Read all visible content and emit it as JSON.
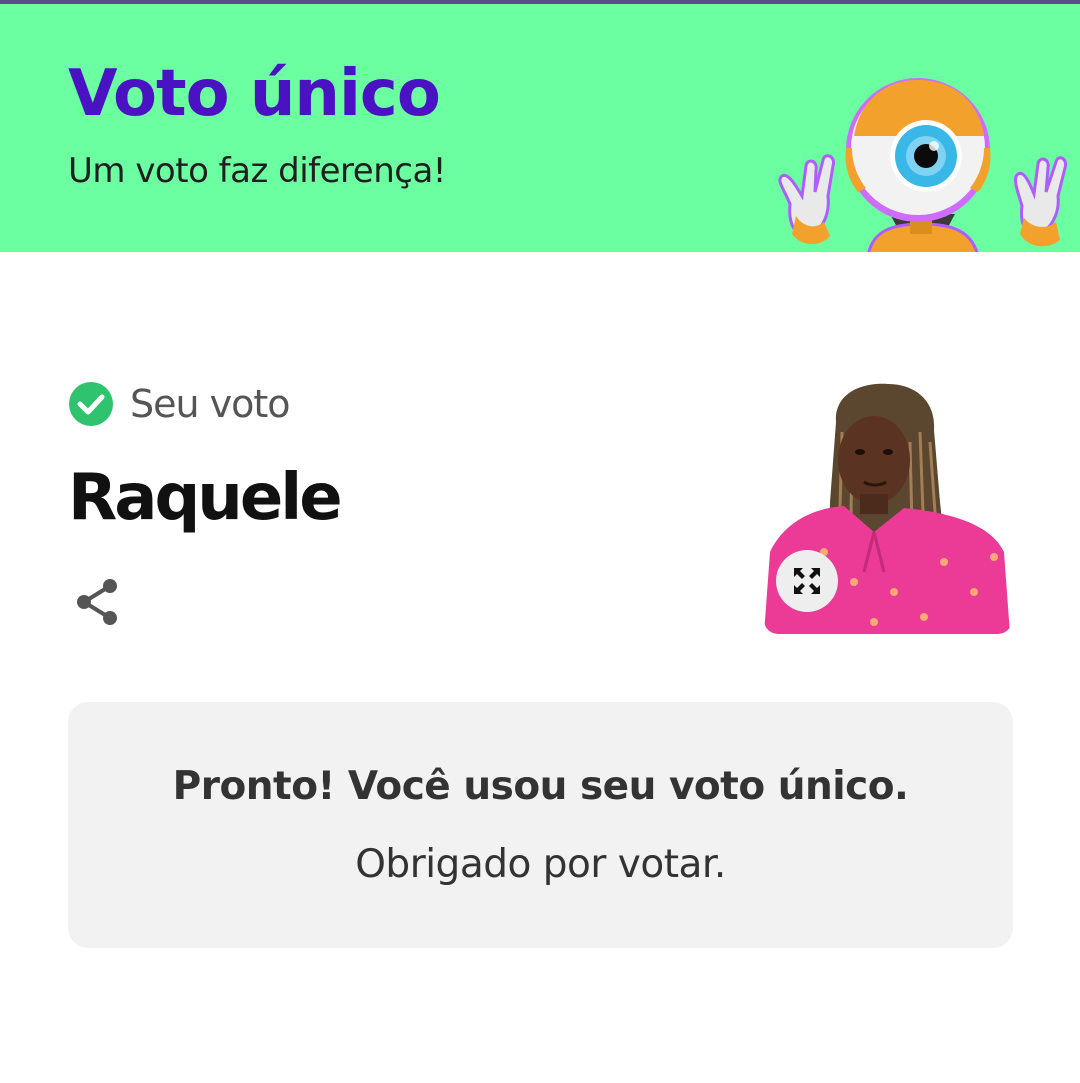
{
  "banner": {
    "title": "Voto único",
    "subtitle": "Um voto faz diferença!",
    "mascot_icon": "big-brother-eye-mascot"
  },
  "vote": {
    "label": "Seu voto",
    "candidate_name": "Raquele",
    "check_icon": "check-circle-icon",
    "share_icon": "share-icon",
    "expand_icon": "expand-icon"
  },
  "message": {
    "title": "Pronto! Você usou seu voto único.",
    "text": "Obrigado por votar."
  },
  "colors": {
    "banner_bg": "#6bffa1",
    "title": "#4b12c4",
    "check": "#2fc36f",
    "message_bg": "#f2f2f2"
  }
}
